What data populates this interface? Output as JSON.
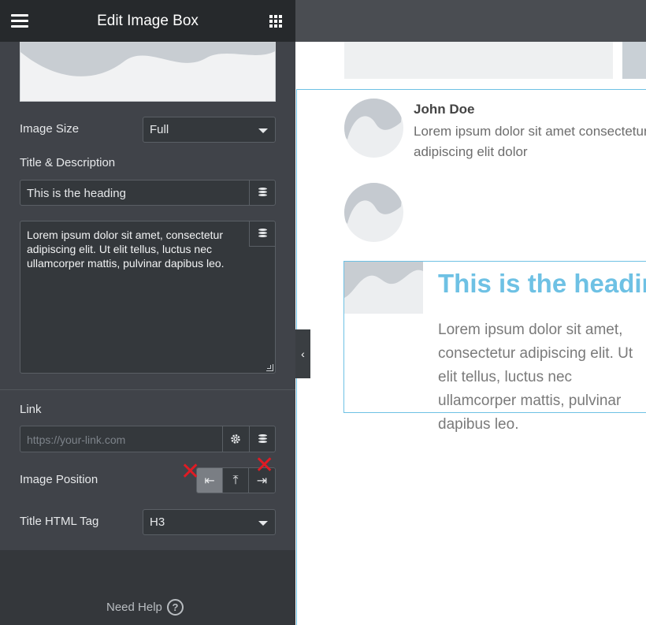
{
  "header": {
    "title": "Edit Image Box",
    "menu_icon": "hamburger-menu-icon",
    "grid_icon": "apps-grid-icon"
  },
  "controls": {
    "image_size": {
      "label": "Image Size",
      "value": "Full"
    },
    "title_description": {
      "label": "Title & Description",
      "title_value": "This is the heading",
      "description_value": "Lorem ipsum dolor sit amet, consectetur adipiscing elit. Ut elit tellus, luctus nec ullamcorper mattis, pulvinar dapibus leo."
    },
    "link": {
      "label": "Link",
      "placeholder": "https://your-link.com"
    },
    "image_position": {
      "label": "Image Position",
      "options": [
        "left",
        "top",
        "right"
      ],
      "selected": "left"
    },
    "title_html_tag": {
      "label": "Title HTML Tag",
      "value": "H3"
    }
  },
  "footer": {
    "help_label": "Need Help",
    "help_icon": "question-circle-icon"
  },
  "canvas": {
    "testimonial": {
      "name": "John Doe",
      "text": "Lorem ipsum dolor sit amet consectetur adipiscing elit dolor"
    },
    "image_box": {
      "heading": "This is the heading",
      "text": "Lorem ipsum dolor sit amet, consectetur adipiscing elit. Ut elit tellus, luctus nec ullamcorper mattis, pulvinar dapibus leo."
    }
  },
  "colors": {
    "accent": "#6ec1e4",
    "panel_bg": "#404349",
    "topbar_bg": "#26292c",
    "mark_red": "#e01b24"
  }
}
